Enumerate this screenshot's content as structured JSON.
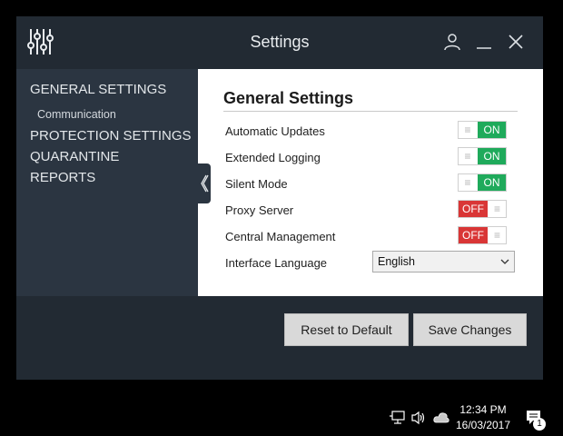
{
  "window": {
    "title": "Settings"
  },
  "sidebar": {
    "items": [
      {
        "label": "GENERAL SETTINGS"
      },
      {
        "label": "Communication"
      },
      {
        "label": "PROTECTION SETTINGS"
      },
      {
        "label": "QUARANTINE"
      },
      {
        "label": "REPORTS"
      }
    ]
  },
  "content": {
    "title": "General Settings",
    "settings": [
      {
        "label": "Automatic Updates",
        "state": "ON"
      },
      {
        "label": "Extended Logging",
        "state": "ON"
      },
      {
        "label": "Silent Mode",
        "state": "ON"
      },
      {
        "label": "Proxy Server",
        "state": "OFF"
      },
      {
        "label": "Central Management",
        "state": "OFF"
      }
    ],
    "language": {
      "label": "Interface Language",
      "value": "English"
    }
  },
  "footer": {
    "reset_label": "Reset to Default",
    "save_label": "Save Changes"
  },
  "taskbar": {
    "time": "12:34 PM",
    "date": "16/03/2017",
    "notification_count": "1"
  },
  "icons": {
    "app": "sliders-icon",
    "user": "user-icon",
    "minimize": "minimize-icon",
    "close": "close-icon",
    "collapse": "chevron-left-icon",
    "dropdown": "chevron-down-icon",
    "network": "network-icon",
    "volume": "volume-icon",
    "cloud": "cloud-icon",
    "notification": "notification-icon"
  },
  "colors": {
    "window_bg": "#222a33",
    "sidebar_bg": "#2b3541",
    "toggle_on": "#1faa5b",
    "toggle_off": "#d93636",
    "button_bg": "#d9d9d9"
  }
}
